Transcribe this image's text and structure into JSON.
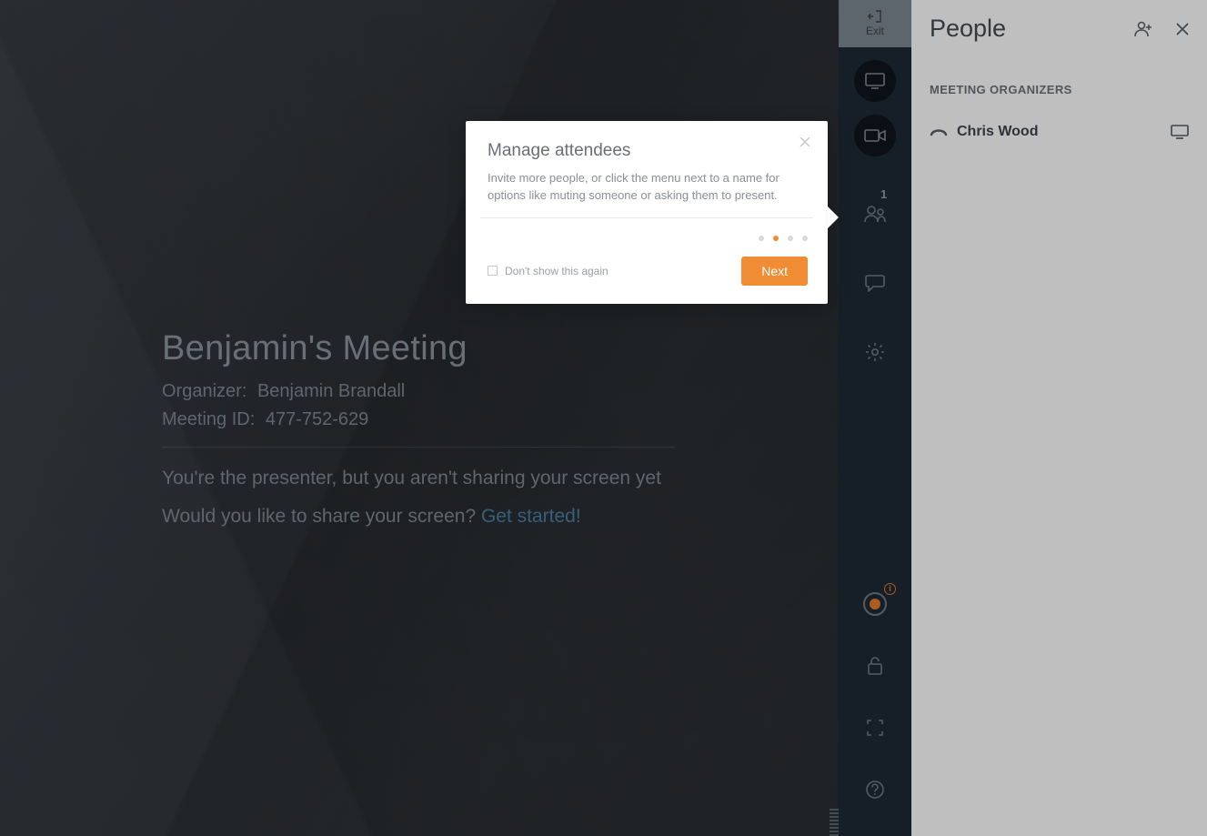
{
  "controls": {
    "exit_label": "Exit",
    "people_count": "1"
  },
  "meeting": {
    "title": "Benjamin's Meeting",
    "organizer_label": "Organizer:",
    "organizer_value": "Benjamin Brandall",
    "id_label": "Meeting ID:",
    "id_value": "477-752-629",
    "presenter_line": "You're the presenter, but you aren't sharing your screen yet",
    "share_prompt": "Would you like to share your screen? ",
    "share_cta": "Get started!"
  },
  "popover": {
    "title": "Manage attendees",
    "body": "Invite more people, or click the menu next to a name for options like muting someone or asking them to present.",
    "dont_show": "Don't show this again",
    "next_label": "Next",
    "step_count": 4,
    "step_active_index": 1
  },
  "people": {
    "panel_title": "People",
    "section_label": "MEETING ORGANIZERS",
    "organizers": [
      {
        "name": "Chris Wood"
      }
    ]
  },
  "colors": {
    "accent_orange": "#f08c33",
    "link_blue": "#4b7fa0"
  }
}
